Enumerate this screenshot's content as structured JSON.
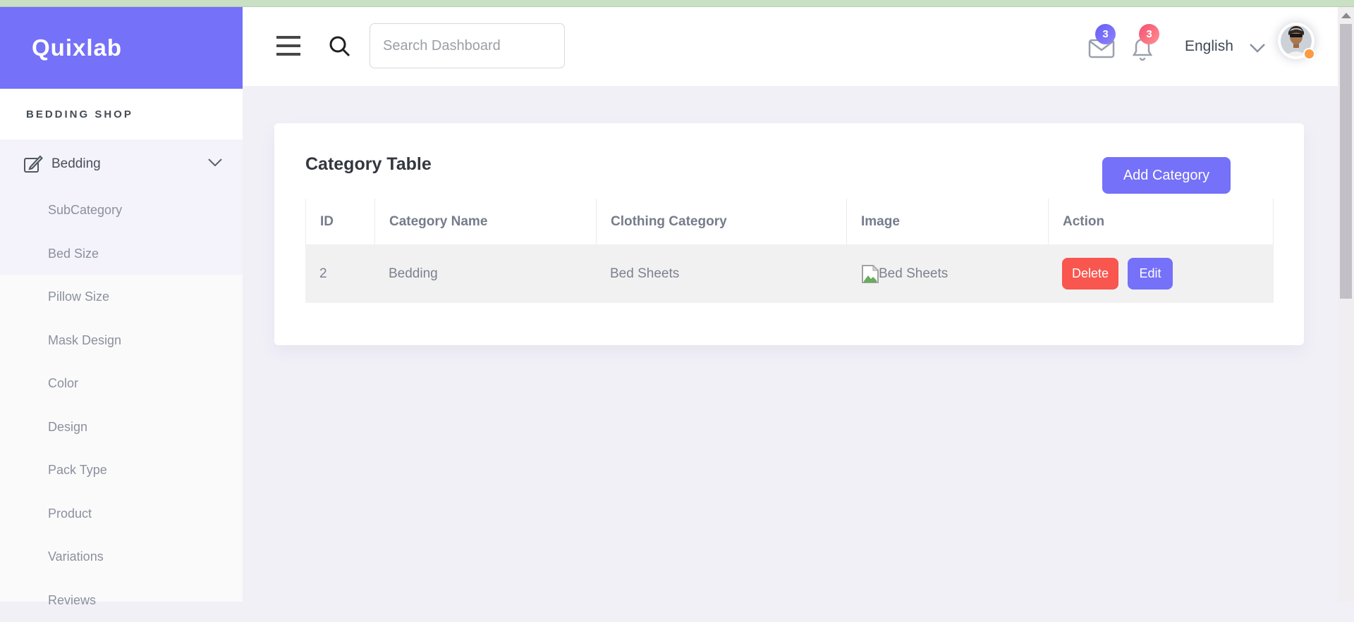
{
  "app": {
    "logo": "Quixlab",
    "colors": {
      "primary": "#7571f9",
      "danger": "#f8564f",
      "top_strip": "#c9e0c4",
      "badge_messages": "#7a6ef9",
      "badge_notifications": "#f9577e",
      "status_dot": "#fb9b44",
      "content_bg": "#f1f0f7"
    }
  },
  "sidebar": {
    "section_label": "BEDDING SHOP",
    "menu": {
      "label": "Bedding",
      "icon": "edit-icon",
      "expanded": true
    },
    "submenu": [
      "SubCategory",
      "Bed Size",
      "Pillow Size",
      "Mask Design",
      "Color",
      "Design",
      "Pack Type",
      "Product",
      "Variations",
      "Reviews"
    ]
  },
  "header": {
    "search_placeholder": "Search Dashboard",
    "messages_badge": "3",
    "notifications_badge": "3",
    "language": "English"
  },
  "main": {
    "card_title": "Category Table",
    "add_button": "Add Category",
    "table": {
      "columns": [
        "ID",
        "Category Name",
        "Clothing Category",
        "Image",
        "Action"
      ],
      "rows": [
        {
          "id": "2",
          "category_name": "Bedding",
          "clothing_category": "Bed Sheets",
          "image_alt": "Bed Sheets",
          "actions": [
            "Delete",
            "Edit"
          ]
        }
      ]
    }
  }
}
